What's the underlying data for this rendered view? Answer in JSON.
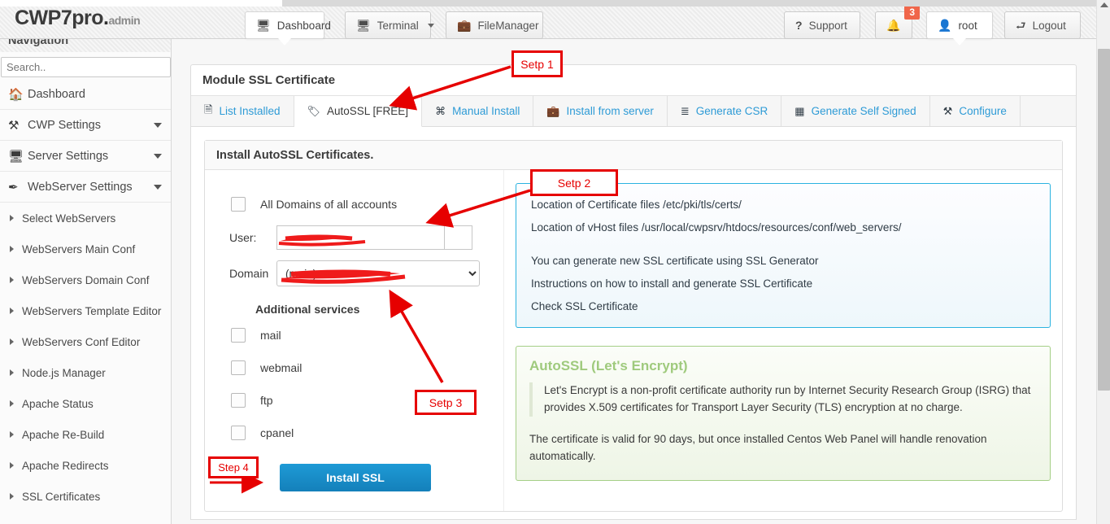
{
  "header": {
    "brand_main": "CWP7pro",
    "brand_dot": ".",
    "brand_admin": "admin",
    "nav": [
      {
        "label": "Dashboard",
        "icon": "monitor-icon",
        "active": true,
        "caret": false
      },
      {
        "label": "Terminal",
        "icon": "monitor-icon",
        "active": false,
        "caret": true
      },
      {
        "label": "FileManager",
        "icon": "briefcase-icon",
        "active": false,
        "caret": false
      }
    ],
    "right": {
      "support_label": "Support",
      "support_icon": "question-mark-icon",
      "notifications_icon": "bell-icon",
      "notifications_count": "3",
      "user_label": "root",
      "user_icon": "user-icon",
      "logout_label": "Logout",
      "logout_icon": "exit-icon"
    }
  },
  "sidebar": {
    "title": "Navigation",
    "search_placeholder": "Search..",
    "search_value": "",
    "groups": [
      {
        "label": "Dashboard",
        "icon": "home-icon",
        "caret": false
      },
      {
        "label": "CWP Settings",
        "icon": "tools-icon",
        "caret": true
      },
      {
        "label": "Server Settings",
        "icon": "server-icon",
        "caret": true
      },
      {
        "label": "WebServer Settings",
        "icon": "wrench-icon",
        "caret": true
      }
    ],
    "items": [
      {
        "label": "Select WebServers"
      },
      {
        "label": "WebServers Main Conf"
      },
      {
        "label": "WebServers Domain Conf"
      },
      {
        "label": "WebServers Template Editor"
      },
      {
        "label": "WebServers Conf Editor"
      },
      {
        "label": "Node.js Manager"
      },
      {
        "label": "Apache Status"
      },
      {
        "label": "Apache Re-Build"
      },
      {
        "label": "Apache Redirects"
      },
      {
        "label": "SSL Certificates"
      }
    ]
  },
  "module": {
    "title": "Module SSL Certificate",
    "tabs": [
      {
        "label": "List Installed",
        "icon": "document-icon",
        "active": false
      },
      {
        "label": "AutoSSL [FREE]",
        "icon": "tag-icon",
        "active": true
      },
      {
        "label": "Manual Install",
        "icon": "command-icon",
        "active": false
      },
      {
        "label": "Install from server",
        "icon": "briefcase-icon",
        "active": false
      },
      {
        "label": "Generate CSR",
        "icon": "sliders-icon",
        "active": false
      },
      {
        "label": "Generate Self Signed",
        "icon": "certificate-icon",
        "active": false
      },
      {
        "label": "Configure",
        "icon": "tools-icon",
        "active": false
      }
    ]
  },
  "form": {
    "heading": "Install AutoSSL Certificates.",
    "all_domains_label": "All Domains of all accounts",
    "all_domains_checked": false,
    "user_label": "User:",
    "user_value": "",
    "domain_label": "Domain",
    "domain_selected": "(main)",
    "additional_services_label": "Additional services",
    "services": [
      {
        "label": "mail",
        "checked": false
      },
      {
        "label": "webmail",
        "checked": false
      },
      {
        "label": "ftp",
        "checked": false
      },
      {
        "label": "cpanel",
        "checked": false
      }
    ],
    "install_button": "Install SSL"
  },
  "info_panel": {
    "lines": [
      "Location of Certificate files /etc/pki/tls/certs/",
      "Location of vHost files /usr/local/cwpsrv/htdocs/resources/conf/web_servers/",
      "You can generate new SSL certificate using SSL Generator",
      "Instructions on how to install and generate SSL Certificate",
      "Check SSL Certificate"
    ]
  },
  "autossl_panel": {
    "title": "AutoSSL (Let's Encrypt)",
    "quote": "Let's Encrypt is a non-profit certificate authority run by Internet Security Research Group (ISRG) that provides X.509 certificates for Transport Layer Security (TLS) encryption at no charge.",
    "tail": "The certificate is valid for 90 days, but once installed Centos Web Panel will handle renovation automatically."
  },
  "annotations": [
    {
      "label": "Setp 1"
    },
    {
      "label": "Setp 2"
    },
    {
      "label": "Setp 3"
    },
    {
      "label": "Step 4"
    }
  ],
  "colors": {
    "accent_blue": "#2e9bd6",
    "button_blue": "#1e9ad6",
    "annotation_red": "#e60000",
    "badge_orange": "#f0664a",
    "info_border": "#2bb3e0",
    "autossl_border": "#a5cf87",
    "autossl_title": "#9fca7d"
  }
}
